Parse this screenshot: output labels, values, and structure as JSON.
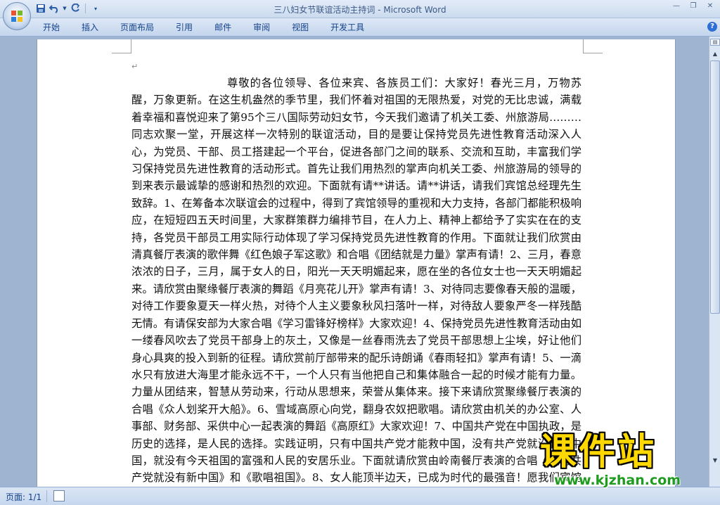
{
  "window": {
    "title": "三八妇女节联谊活动主持词 - Microsoft Word"
  },
  "ribbon": {
    "tabs": [
      "开始",
      "插入",
      "页面布局",
      "引用",
      "邮件",
      "审阅",
      "视图",
      "开发工具"
    ]
  },
  "icons": {
    "office": "office-logo-icon",
    "save": "save-icon",
    "undo": "undo-icon",
    "redo": "redo-icon",
    "help": "help-icon"
  },
  "document": {
    "paragraph_mark": "↵",
    "body": "尊敬的各位领导、各位来宾、各族员工们：大家好！春光三月，万物苏醒，万象更新。在这生机盎然的季节里，我们怀着对祖国的无限热爱，对党的无比忠诚，满载着幸福和喜悦迎来了第95个三八国际劳动妇女节，今天我们邀请了机关工委、州旅游局………同志欢聚一堂，开展这样一次特别的联谊活动，目的是要让保持党员先进性教育活动深入人心，为党员、干部、员工搭建起一个平台，促进各部门之间的联系、交流和互助，丰富我们学习保持党员先进性教育的活动形式。首先让我们用热烈的掌声向机关工委、州旅游局的领导的到来表示最诚挚的感谢和热烈的欢迎。下面就有请**讲话。请**讲话，请我们宾馆总经理先生致辞。1、在筹备本次联谊会的过程中，得到了宾馆领导的重视和大力支持，各部门都能积极响应，在短短四五天时间里，大家群策群力编排节目，在人力上、精神上都给予了实实在在的支持，各党员干部员工用实际行动体现了学习保持党员先进性教育的作用。下面就让我们欣赏由清真餐厅表演的歌伴舞《红色娘子军这歌》和合唱《团结就是力量》掌声有请！2、三月，春意浓浓的日子，三月，属于女人的日，阳光一天天明媚起来，愿在坐的各位女士也一天天明媚起来。请欣赏由聚缘餐厅表演的舞蹈《月亮花儿开》掌声有请！3、对待同志要像春天般的温暖，对待工作要象夏天一样火热，对待个人主义要象秋风扫落叶一样，对待敌人要象严冬一样残酷无情。有请保安部为大家合唱《学习雷锋好榜样》大家欢迎！4、保持党员先进性教育活动由如一缕春风吹去了党员干部身上的灰土，又像是一丝春雨洗去了党员干部思想上尘埃，好让他们身心具爽的投入到新的征程。请欣赏前厅部带来的配乐诗朗诵《春雨轻扣》掌声有请！5、一滴水只有放进大海里才能永远不干，一个人只有当他把自己和集体融合一起的时候才能有力量。力量从团结来，智慧从劳动来，行动从思想来，荣誉从集体来。接下来请欣赏聚缘餐厅表演的合唱《众人划桨开大船》。6、雪域高原心向党，翻身农奴把歌唱。请欣赏由机关的办公室、人事部、财务部、采供中心一起表演的舞蹈《高原红》大家欢迎！7、中国共产党在中国执政，是历史的选择，是人民的选择。实践证明，只有中国共产党才能救中国，没有共产党就没有新中国，就没有今天祖国的富强和人民的安居乐业。下面就请欣赏由岭南餐厅表演的合唱《没有共产党就没有新中国》和《歌唱祖国》。8、女人能顶半边天，已成为时代的最强音！愿我们宾馆的每一位女性都能成为“巾帼不让须眉”的精英"
  },
  "status": {
    "page": "页面: 1/1"
  },
  "watermark": {
    "title": "课件站",
    "url": "www.kjzhan.com"
  }
}
